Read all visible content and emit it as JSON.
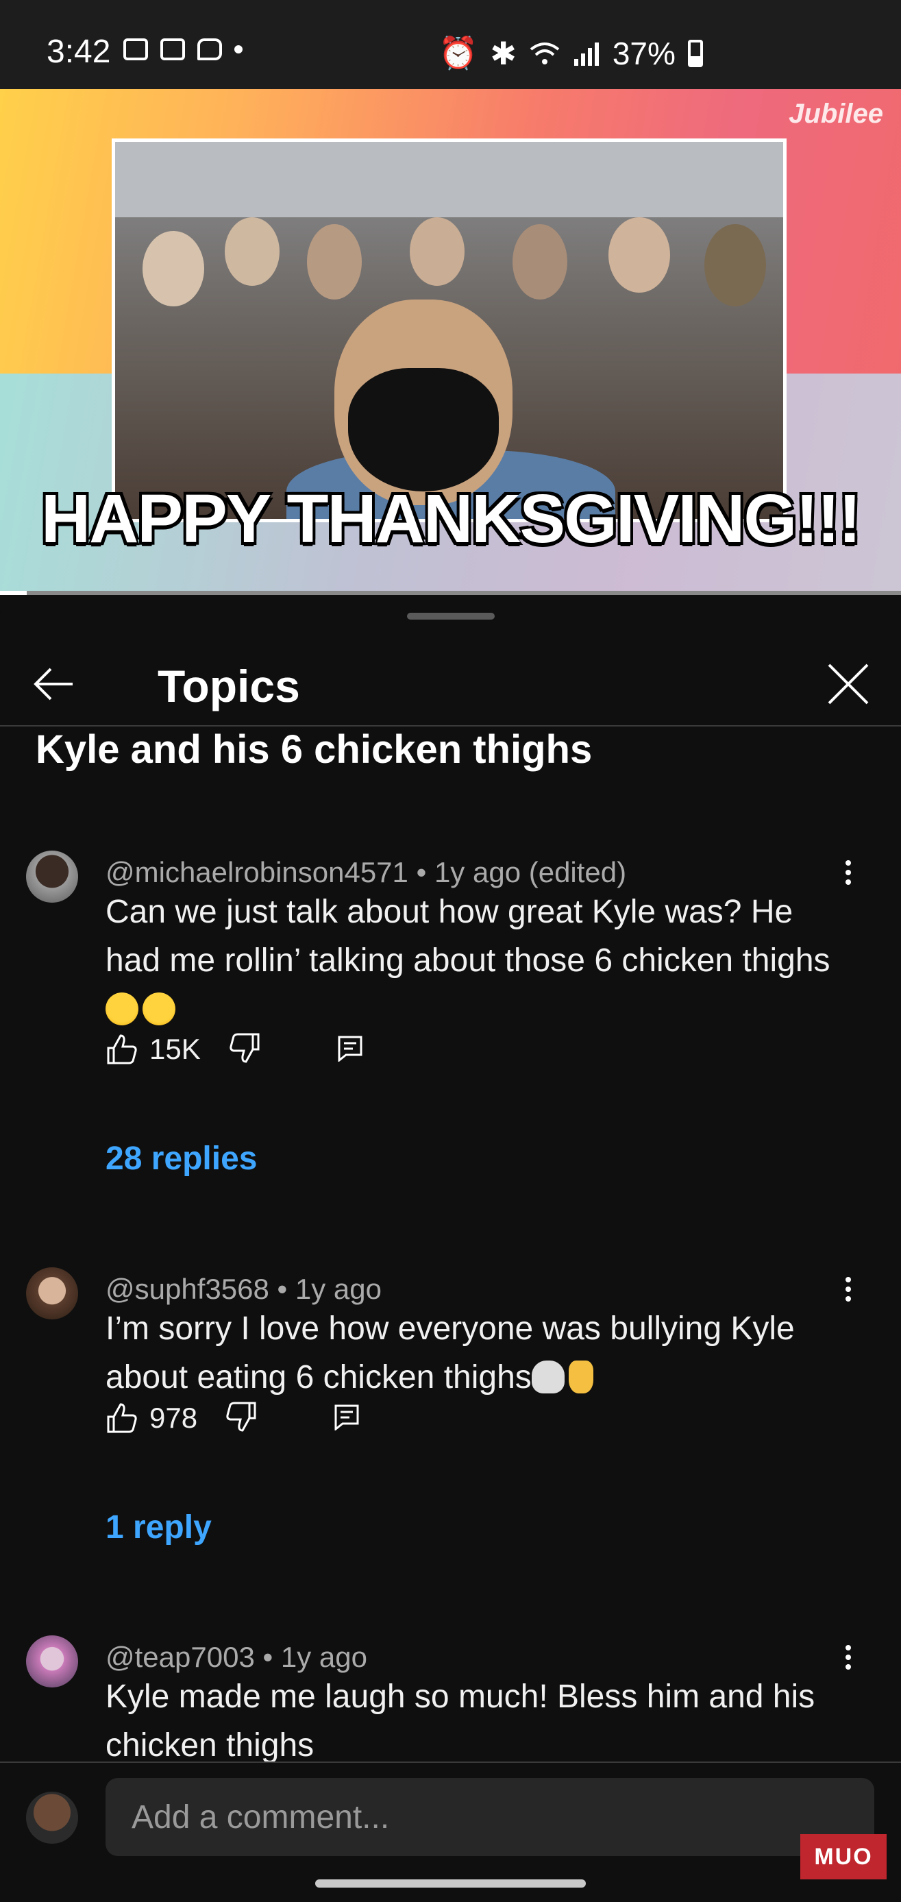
{
  "status_bar": {
    "time": "3:42",
    "battery": "37%",
    "battery_level": 0.37
  },
  "video": {
    "caption": "HAPPY THANKSGIVING!!!",
    "channel_watermark": "Jubilee",
    "progress": 0.03
  },
  "sheet": {
    "title": "Topics",
    "topic_title": "Kyle and his 6 chicken thighs"
  },
  "comments": [
    {
      "author": "@michaelrobinson4571",
      "meta": " • 1y ago (edited)",
      "text": "Can we just talk about how great Kyle was? He had me rollin’ talking about those 6 chicken thighs",
      "emoji": [
        "laughing-emoji",
        "laughing-emoji"
      ],
      "likes": "15K",
      "replies": "28 replies"
    },
    {
      "author": "@suphf3568",
      "meta": " • 1y ago",
      "text": "I’m sorry I love how everyone was bullying Kyle about eating 6 chicken thighs",
      "emoji": [
        "skull-emoji",
        "raised-hand-emoji"
      ],
      "likes": "978",
      "replies": "1 reply"
    },
    {
      "author": "@teap7003",
      "meta": " • 1y ago",
      "text": "Kyle made me laugh so much! Bless him and his chicken thighs",
      "emoji": []
    }
  ],
  "composer": {
    "placeholder": "Add a comment..."
  },
  "watermark": "MUO",
  "colors": {
    "background": "#0f0f0f",
    "link": "#3ea6ff",
    "meta_text": "#aaaaaa",
    "input_bg": "#272727"
  }
}
